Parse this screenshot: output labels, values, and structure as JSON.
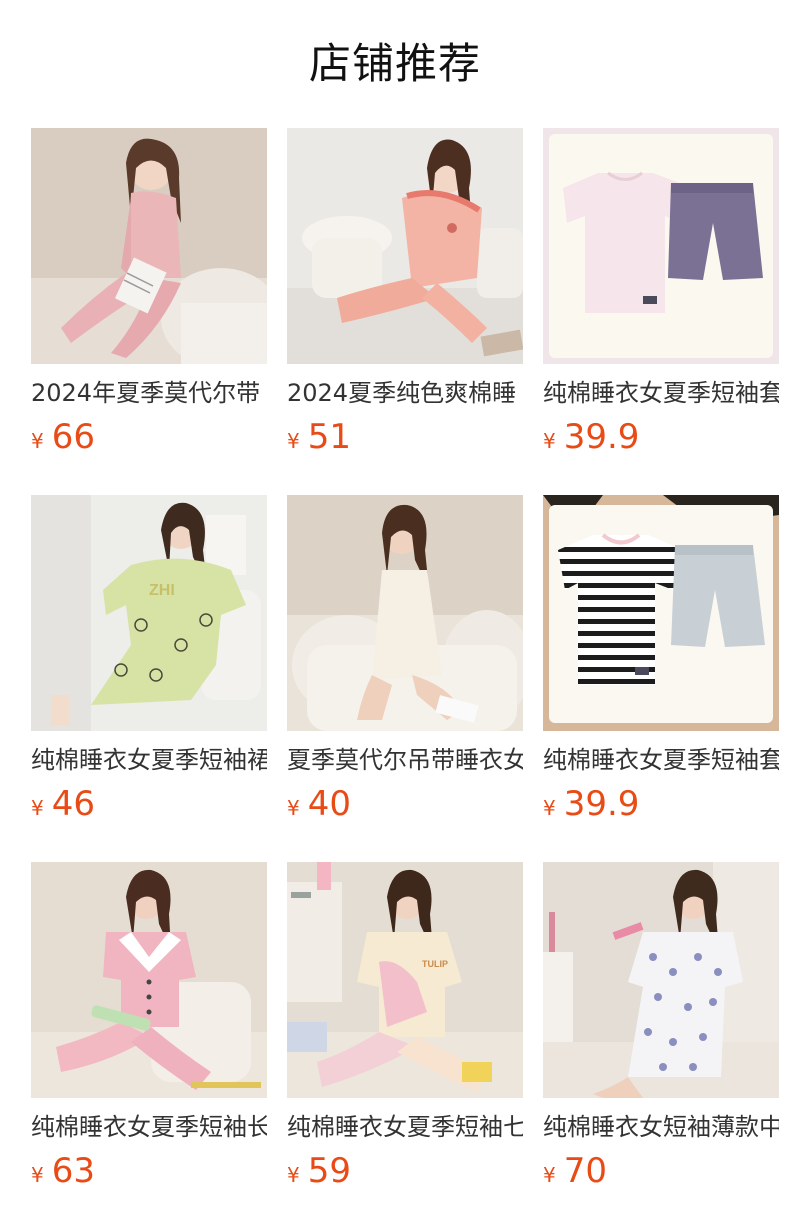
{
  "header": {
    "title": "店铺推荐"
  },
  "currency_symbol": "¥",
  "products": [
    {
      "name": "2024年夏季莫代尔带",
      "price": "66"
    },
    {
      "name": "2024夏季纯色爽棉睡",
      "price": "51"
    },
    {
      "name": "纯棉睡衣女夏季短袖套",
      "price": "39.9"
    },
    {
      "name": "纯棉睡衣女夏季短袖裙",
      "price": "46"
    },
    {
      "name": "夏季莫代尔吊带睡衣女",
      "price": "40"
    },
    {
      "name": "纯棉睡衣女夏季短袖套",
      "price": "39.9"
    },
    {
      "name": "纯棉睡衣女夏季短袖长",
      "price": "63"
    },
    {
      "name": "纯棉睡衣女夏季短袖七",
      "price": "59"
    },
    {
      "name": "纯棉睡衣女短袖薄款中",
      "price": "70"
    }
  ],
  "colors": {
    "price": "#e84b16",
    "title": "#111111",
    "name": "#333333"
  }
}
